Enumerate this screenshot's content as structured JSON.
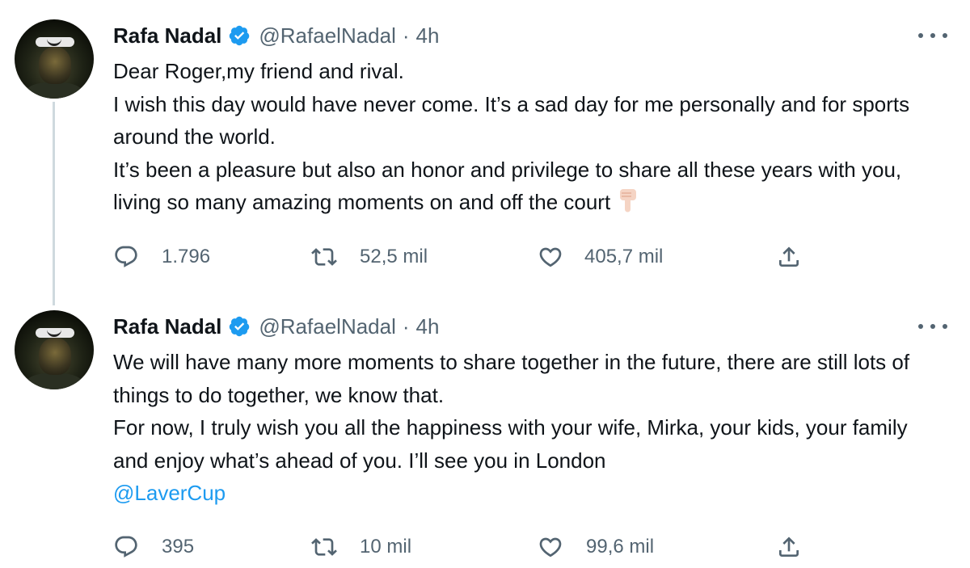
{
  "tweets": [
    {
      "author_name": "Rafa Nadal",
      "handle": "@RafaelNadal",
      "separator": "·",
      "time": "4h",
      "lines": [
        "Dear Roger,my friend and rival.",
        "I wish this day would have never come. It’s a sad day for me personally and for sports around the world.",
        "It’s been a pleasure but also an honor and privilege to share all these years with you, living so many amazing moments on and off the court"
      ],
      "replies": "1.796",
      "retweets": "52,5 mil",
      "likes": "405,7 mil"
    },
    {
      "author_name": "Rafa Nadal",
      "handle": "@RafaelNadal",
      "separator": "·",
      "time": "4h",
      "lines": [
        "We will have many more moments to share together in the future, there are still lots of things to do together, we know that.",
        "For now, I truly wish you all the happiness with your wife, Mirka, your kids, your family and enjoy what’s ahead of you. I’ll see you in London"
      ],
      "mention": "@LaverCup",
      "replies": "395",
      "retweets": "10 mil",
      "likes": "99,6 mil"
    }
  ],
  "icons": {
    "verified": "verified-badge-icon",
    "more": "more-options-icon",
    "reply": "reply-icon",
    "retweet": "retweet-icon",
    "like": "heart-icon",
    "share": "share-icon",
    "pointer": "backhand-index-pointing-down-emoji"
  },
  "colors": {
    "text": "#0f1419",
    "secondary": "#536471",
    "accent": "#1d9bf0",
    "thread_line": "#cfd9de"
  }
}
